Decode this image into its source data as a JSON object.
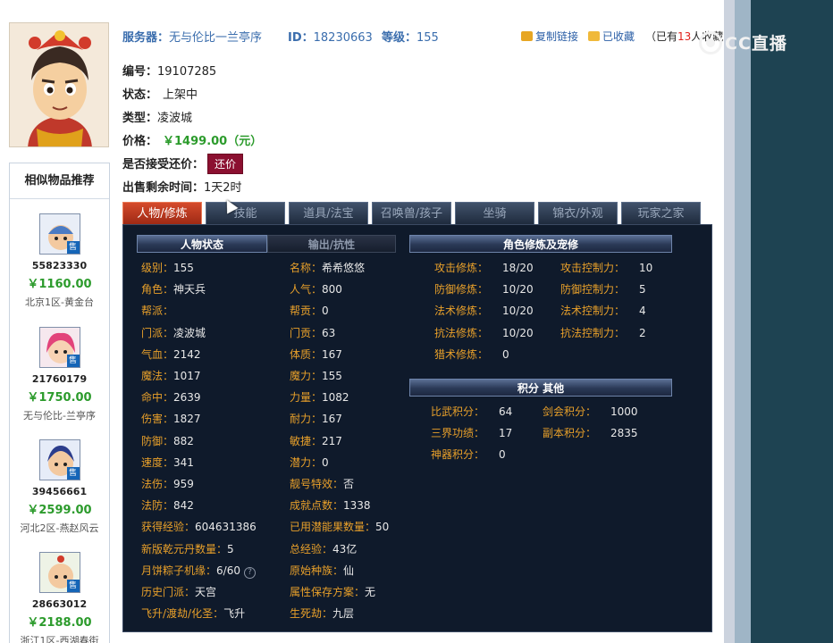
{
  "header": {
    "server_label": "服务器：",
    "server_value": "无与伦比一兰亭序",
    "id_label": "ID：",
    "id_value": "18230663",
    "level_label": "等级：",
    "level_value": "155",
    "copy_link": "复制链接",
    "favorited": "已收藏",
    "fav_prefix": "（已有",
    "fav_count": "13",
    "fav_suffix": "人收藏"
  },
  "watermark": "CC直播",
  "info": {
    "serial_label": "编号：",
    "serial_value": "19107285",
    "status_label": "状态：",
    "status_value": "上架中",
    "type_label": "类型：",
    "type_value": "凌波城",
    "price_label": "价格：",
    "price_value": "￥1499.00（元）",
    "bargain_label": "是否接受还价：",
    "bargain_button": "还价",
    "time_left_label": "出售剩余时间：",
    "time_left_value": "1天2时"
  },
  "recommend": {
    "title": "相似物品推荐",
    "tag": "售",
    "items": [
      {
        "id": "55823330",
        "price": "￥1160.00",
        "server": "北京1区-黄金台"
      },
      {
        "id": "21760179",
        "price": "￥1750.00",
        "server": "无与伦比-兰亭序"
      },
      {
        "id": "39456661",
        "price": "￥2599.00",
        "server": "河北2区-燕赵风云"
      },
      {
        "id": "28663012",
        "price": "￥2188.00",
        "server": "浙江1区-西湖春街"
      }
    ]
  },
  "tabs": [
    "人物/修炼",
    "技能",
    "道具/法宝",
    "召唤兽/孩子",
    "坐骑",
    "锦衣/外观",
    "玩家之家"
  ],
  "sections": {
    "char_status": "人物状态",
    "output_resist": "输出/抗性",
    "cultivation": "角色修炼及宠修",
    "points_other": "积分  其他"
  },
  "stats_left": [
    {
      "k": "级别：",
      "v": "155"
    },
    {
      "k": "角色：",
      "v": "神天兵"
    },
    {
      "k": "帮派：",
      "v": ""
    },
    {
      "k": "门派：",
      "v": "凌波城"
    },
    {
      "k": "气血：",
      "v": "2142"
    },
    {
      "k": "魔法：",
      "v": "1017"
    },
    {
      "k": "命中：",
      "v": "2639"
    },
    {
      "k": "伤害：",
      "v": "1827"
    },
    {
      "k": "防御：",
      "v": "882"
    },
    {
      "k": "速度：",
      "v": "341"
    },
    {
      "k": "法伤：",
      "v": "959"
    },
    {
      "k": "法防：",
      "v": "842"
    },
    {
      "k": "获得经验：",
      "v": "604631386"
    },
    {
      "k": "新版乾元丹数量：",
      "v": "5"
    },
    {
      "k": "月饼粽子机缘：",
      "v": "6/60"
    },
    {
      "k": "历史门派：",
      "v": "天宫"
    },
    {
      "k": "飞升/渡劫/化圣：",
      "v": "飞升"
    }
  ],
  "stats_right": [
    {
      "k": "名称：",
      "v": "希希悠悠"
    },
    {
      "k": "人气：",
      "v": "800"
    },
    {
      "k": "帮贡：",
      "v": "0"
    },
    {
      "k": "门贡：",
      "v": "63"
    },
    {
      "k": "体质：",
      "v": "167"
    },
    {
      "k": "魔力：",
      "v": "155"
    },
    {
      "k": "力量：",
      "v": "1082"
    },
    {
      "k": "耐力：",
      "v": "167"
    },
    {
      "k": "敏捷：",
      "v": "217"
    },
    {
      "k": "潜力：",
      "v": "0"
    },
    {
      "k": "靓号特效：",
      "v": "否"
    },
    {
      "k": "成就点数：",
      "v": "1338"
    },
    {
      "k": "已用潜能果数量：",
      "v": "50"
    },
    {
      "k": "总经验：",
      "v": "43亿"
    },
    {
      "k": "原始种族：",
      "v": "仙"
    },
    {
      "k": "属性保存方案：",
      "v": "无"
    },
    {
      "k": "生死劫：",
      "v": "九层"
    }
  ],
  "cultivation": [
    {
      "k": "攻击修炼：",
      "v": "18/20",
      "k2": "攻击控制力：",
      "v2": "10"
    },
    {
      "k": "防御修炼：",
      "v": "10/20",
      "k2": "防御控制力：",
      "v2": "5"
    },
    {
      "k": "法术修炼：",
      "v": "10/20",
      "k2": "法术控制力：",
      "v2": "4"
    },
    {
      "k": "抗法修炼：",
      "v": "10/20",
      "k2": "抗法控制力：",
      "v2": "2"
    },
    {
      "k": "猎术修炼：",
      "v": "0",
      "k2": "",
      "v2": ""
    }
  ],
  "points": [
    {
      "k": "比武积分：",
      "v": "64",
      "k2": "剑会积分：",
      "v2": "1000"
    },
    {
      "k": "三界功绩：",
      "v": "17",
      "k2": "副本积分：",
      "v2": "2835"
    },
    {
      "k": "神器积分：",
      "v": "0",
      "k2": "",
      "v2": ""
    }
  ]
}
